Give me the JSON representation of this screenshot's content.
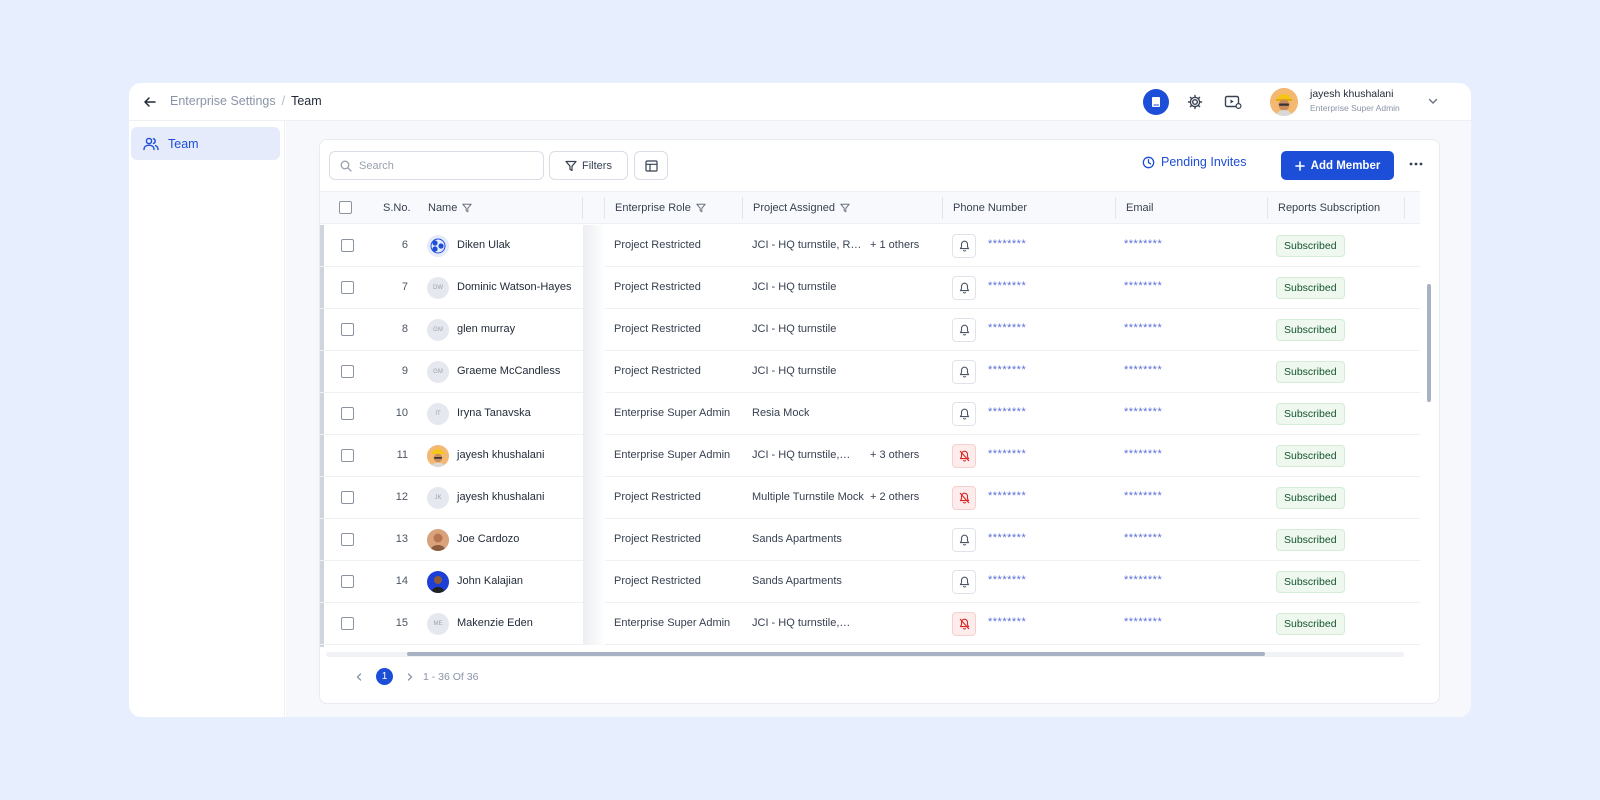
{
  "topbar": {
    "breadcrumb_parent": "Enterprise Settings",
    "breadcrumb_sep": "/",
    "breadcrumb_current": "Team",
    "user_name": "jayesh khushalani",
    "user_role": "Enterprise Super Admin"
  },
  "sidebar": {
    "items": [
      {
        "label": "Team",
        "icon": "team-icon"
      }
    ]
  },
  "toolbar": {
    "search_placeholder": "Search",
    "filters_label": "Filters",
    "pending_label": "Pending Invites",
    "add_label": "Add Member"
  },
  "table": {
    "headers": {
      "sno": "S.No.",
      "name": "Name",
      "role": "Enterprise Role",
      "project": "Project Assigned",
      "phone": "Phone Number",
      "email": "Email",
      "reports": "Reports Subscription"
    },
    "rows": [
      {
        "sno": "6",
        "initials": "",
        "avatar": "logo",
        "name": "Diken Ulak",
        "role": "Project Restricted",
        "project": "JCI - HQ turnstile, Resia Mock",
        "others": "+ 1 others",
        "notify": true,
        "phone": "********",
        "email": "********",
        "reports": "Subscribed"
      },
      {
        "sno": "7",
        "initials": "DW",
        "avatar": "initials",
        "name": "Dominic Watson-Hayes",
        "role": "Project Restricted",
        "project": "JCI - HQ turnstile",
        "others": "",
        "notify": true,
        "phone": "********",
        "email": "********",
        "reports": "Subscribed"
      },
      {
        "sno": "8",
        "initials": "GM",
        "avatar": "initials",
        "name": "glen murray",
        "role": "Project Restricted",
        "project": "JCI - HQ turnstile",
        "others": "",
        "notify": true,
        "phone": "********",
        "email": "********",
        "reports": "Subscribed"
      },
      {
        "sno": "9",
        "initials": "GM",
        "avatar": "initials",
        "name": "Graeme McCandless",
        "role": "Project Restricted",
        "project": "JCI - HQ turnstile",
        "others": "",
        "notify": true,
        "phone": "********",
        "email": "********",
        "reports": "Subscribed"
      },
      {
        "sno": "10",
        "initials": "IT",
        "avatar": "initials",
        "name": "Iryna Tanavska",
        "role": "Enterprise Super Admin",
        "project": "Resia Mock",
        "others": "",
        "notify": true,
        "phone": "********",
        "email": "********",
        "reports": "Subscribed"
      },
      {
        "sno": "11",
        "initials": "",
        "avatar": "photo-hardhat",
        "name": "jayesh khushalani",
        "role": "Enterprise Super Admin",
        "project": "JCI - HQ turnstile,…",
        "others": "+ 3 others",
        "notify": false,
        "phone": "********",
        "email": "********",
        "reports": "Subscribed"
      },
      {
        "sno": "12",
        "initials": "JK",
        "avatar": "initials",
        "name": "jayesh khushalani",
        "role": "Project Restricted",
        "project": "Multiple Turnstile Mock",
        "others": "+ 2 others",
        "notify": false,
        "phone": "********",
        "email": "********",
        "reports": "Subscribed"
      },
      {
        "sno": "13",
        "initials": "",
        "avatar": "photo-warm",
        "name": "Joe Cardozo",
        "role": "Project Restricted",
        "project": "Sands Apartments",
        "others": "",
        "notify": true,
        "phone": "********",
        "email": "********",
        "reports": "Subscribed"
      },
      {
        "sno": "14",
        "initials": "",
        "avatar": "photo-blue",
        "name": "John Kalajian",
        "role": "Project Restricted",
        "project": "Sands Apartments",
        "others": "",
        "notify": true,
        "phone": "********",
        "email": "********",
        "reports": "Subscribed"
      },
      {
        "sno": "15",
        "initials": "ME",
        "avatar": "initials",
        "name": "Makenzie Eden",
        "role": "Enterprise Super Admin",
        "project": "JCI - HQ turnstile,…",
        "others": "",
        "notify": false,
        "phone": "********",
        "email": "********",
        "reports": "Subscribed"
      }
    ]
  },
  "pagination": {
    "current_page": "1",
    "range_text": "1 - 36 Of 36"
  },
  "colors": {
    "accent": "#1d4ed8",
    "background": "#e7eefd",
    "subscribed_bg": "#eef8ee",
    "notify_off_bg": "#fdecec"
  }
}
